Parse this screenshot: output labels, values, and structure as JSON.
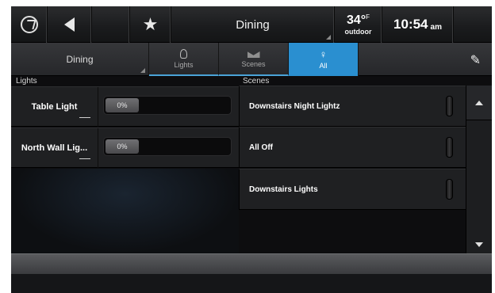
{
  "header": {
    "room_title": "Dining",
    "temperature": "34°",
    "temperature_unit": "F",
    "temperature_label": "outdoor",
    "time": "10:54",
    "time_ampm": "am"
  },
  "tabs": {
    "room_select": "Dining",
    "items": [
      {
        "label": "Lights",
        "icon": "bulb-icon"
      },
      {
        "label": "Scenes",
        "icon": "scenes-icon"
      },
      {
        "label": "All",
        "icon": "all-icon",
        "selected": true
      }
    ]
  },
  "lights": {
    "heading": "Lights",
    "items": [
      {
        "name": "Table Light",
        "level_label": "0%",
        "level": 0
      },
      {
        "name": "North Wall Lig...",
        "level_label": "0%",
        "level": 0
      }
    ]
  },
  "scenes": {
    "heading": "Scenes",
    "items": [
      {
        "name": "Downstairs Night Lightz"
      },
      {
        "name": "All Off"
      },
      {
        "name": "Downstairs Lights"
      }
    ]
  },
  "colors": {
    "accent": "#2a8fd0",
    "background": "#0d0d0f"
  }
}
